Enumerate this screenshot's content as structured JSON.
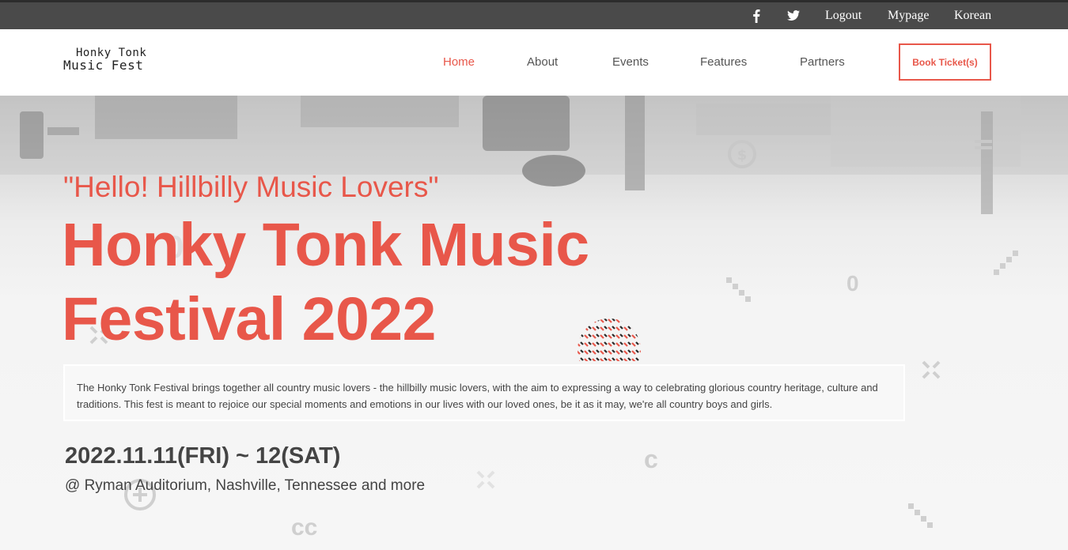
{
  "topbar": {
    "facebook_icon": "facebook-icon",
    "twitter_icon": "twitter-icon",
    "logout": "Logout",
    "mypage": "Mypage",
    "language": "Korean"
  },
  "brand": {
    "line1": "Honky Tonk",
    "line2": "Music Fest"
  },
  "nav": {
    "items": [
      {
        "label": "Home",
        "active": true
      },
      {
        "label": "About",
        "active": false
      },
      {
        "label": "Events",
        "active": false
      },
      {
        "label": "Features",
        "active": false
      },
      {
        "label": "Partners",
        "active": false
      }
    ],
    "book_label": "Book Ticket(s)"
  },
  "hero": {
    "tagline": "\"Hello! Hillbilly Music Lovers\"",
    "title": "Honky Tonk Music Festival 2022",
    "description": "The Honky Tonk Festival brings together all country music lovers - the hillbilly music lovers, with the aim to expressing a way to celebrating glorious country heritage, culture and traditions. This fest is meant to rejoice our special moments and emotions in our lives with our loved ones, be it as it may, we're all country boys and girls.",
    "date": "2022.11.11(FRI) ~ 12(SAT)",
    "venue": "@ Ryman Auditorium, Nashville, Tennessee and more"
  },
  "colors": {
    "accent": "#e8574a",
    "topbar_bg": "#4a4a4a",
    "text": "#444444"
  }
}
